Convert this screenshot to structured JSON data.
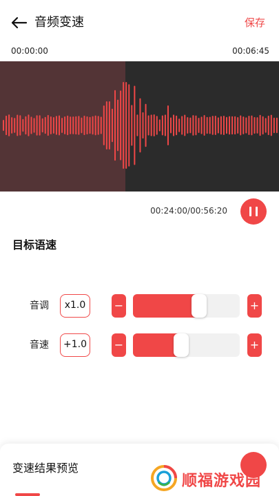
{
  "header": {
    "title": "音频变速",
    "save_label": "保存",
    "back_icon": "arrow-left-icon"
  },
  "timeline": {
    "start_time": "00:00:00",
    "end_time": "00:06:45",
    "played_fraction": 0.45
  },
  "playback": {
    "progress_text": "00:24:00/00:56:20",
    "pause_icon": "pause-icon"
  },
  "section": {
    "title": "目标语速"
  },
  "controls": [
    {
      "label": "音调",
      "value": "x1.0",
      "minus": "−",
      "plus": "+",
      "level": 0.62
    },
    {
      "label": "音速",
      "value": "+1.0",
      "minus": "−",
      "plus": "+",
      "level": 0.45
    }
  ],
  "bottom": {
    "title": "变速结果预览"
  },
  "watermark": {
    "text": "顺福游戏园"
  },
  "colors": {
    "accent": "#f04747",
    "wave_bg": "#2b2b2b",
    "wave_played_bg": "#533436",
    "track_bg": "#f1f1f1"
  }
}
